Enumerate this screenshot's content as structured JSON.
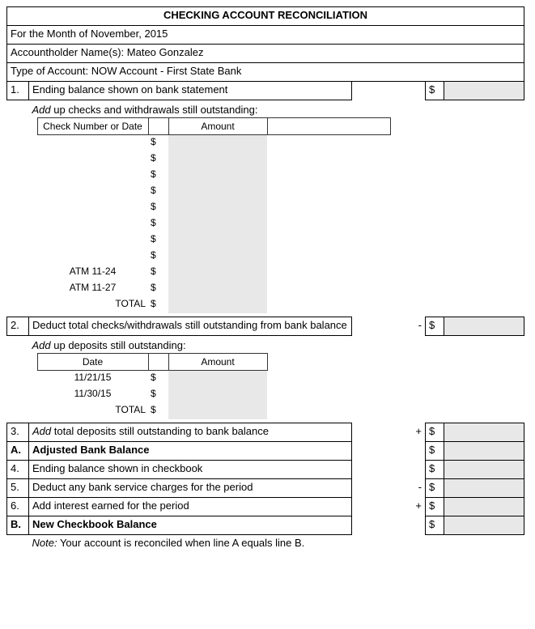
{
  "title": "CHECKING ACCOUNT RECONCILIATION",
  "header": {
    "month_line": "For the Month of November, 2015",
    "name_line": "Accountholder Name(s): Mateo Gonzalez",
    "type_line": "Type of Account: NOW Account - First State Bank"
  },
  "rows": {
    "r1": {
      "num": "1.",
      "label": "Ending balance shown on bank statement",
      "sign": "",
      "dollar": "$",
      "amount": ""
    },
    "checks_intro": "Add up checks and withdrawals still outstanding:",
    "checks_table": {
      "header_left": "Check Number or Date",
      "header_amount": "Amount",
      "rows": [
        {
          "left": "",
          "dollar": "$",
          "amount": "",
          "right": ""
        },
        {
          "left": "",
          "dollar": "$",
          "amount": "",
          "right": ""
        },
        {
          "left": "",
          "dollar": "$",
          "amount": "",
          "right": ""
        },
        {
          "left": "",
          "dollar": "$",
          "amount": "",
          "right": ""
        },
        {
          "left": "",
          "dollar": "$",
          "amount": "",
          "right": ""
        },
        {
          "left": "",
          "dollar": "$",
          "amount": "",
          "right": ""
        },
        {
          "left": "",
          "dollar": "$",
          "amount": "",
          "right": ""
        },
        {
          "left": "",
          "dollar": "$",
          "amount": "",
          "right": ""
        },
        {
          "left": "ATM 11-24",
          "dollar": "$",
          "amount": "",
          "right": ""
        },
        {
          "left": "ATM 11-27",
          "dollar": "$",
          "amount": "",
          "right": ""
        }
      ],
      "total_label": "TOTAL",
      "total_dollar": "$",
      "total_amount": ""
    },
    "r2": {
      "num": "2.",
      "label": "Deduct total checks/withdrawals still outstanding from bank balance",
      "sign": "-",
      "dollar": "$",
      "amount": ""
    },
    "deposits_intro": "Add up deposits still outstanding:",
    "deposits_table": {
      "header_left": "Date",
      "header_amount": "Amount",
      "rows": [
        {
          "left": "11/21/15",
          "dollar": "$",
          "amount": ""
        },
        {
          "left": "11/30/15",
          "dollar": "$",
          "amount": ""
        }
      ],
      "total_label": "TOTAL",
      "total_dollar": "$",
      "total_amount": ""
    },
    "r3": {
      "num": "3.",
      "label": "Add total deposits still outstanding to bank balance",
      "sign": "+",
      "dollar": "$",
      "amount": ""
    },
    "rA": {
      "num": "A.",
      "label": "Adjusted Bank Balance",
      "sign": "",
      "dollar": "$",
      "amount": ""
    },
    "r4": {
      "num": "4.",
      "label": "Ending balance shown in checkbook",
      "sign": "",
      "dollar": "$",
      "amount": ""
    },
    "r5": {
      "num": "5.",
      "label": "Deduct any bank service charges for the period",
      "sign": "-",
      "dollar": "$",
      "amount": ""
    },
    "r6": {
      "num": "6.",
      "label": "Add interest earned for the period",
      "sign": "+",
      "dollar": "$",
      "amount": ""
    },
    "rB": {
      "num": "B.",
      "label": "New Checkbook Balance",
      "sign": "",
      "dollar": "$",
      "amount": ""
    },
    "note_prefix": "Note:",
    "note_text": " Your account is reconciled when line A equals line B.",
    "add_word": "Add"
  }
}
